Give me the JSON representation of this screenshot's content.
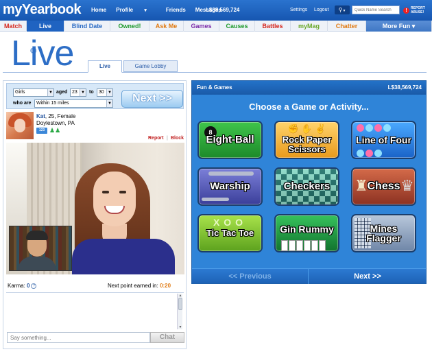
{
  "header": {
    "logo": "myYearbook",
    "nav": [
      "Home",
      "Profile",
      "Friends",
      "Messages"
    ],
    "profile_caret": "▾",
    "credits": "L$38,569,724",
    "settings": "Settings",
    "logout": "Logout",
    "search_placeholder": "Quick Name Search",
    "report_abuse": "REPORT ABUSE!"
  },
  "subnav": [
    {
      "label": "Match",
      "color": "#d6281e"
    },
    {
      "label": "Live",
      "color": "#ffffff",
      "active": true
    },
    {
      "label": "Blind Date",
      "color": "#2a6bc4"
    },
    {
      "label": "Owned!",
      "color": "#1f9a2e"
    },
    {
      "label": "Ask Me",
      "color": "#e07a12"
    },
    {
      "label": "Games",
      "color": "#7a2aa8"
    },
    {
      "label": "Causes",
      "color": "#1f9a2e"
    },
    {
      "label": "Battles",
      "color": "#d6281e"
    },
    {
      "label": "myMag",
      "color": "#6aa82a"
    },
    {
      "label": "Chatter",
      "color": "#e07a12"
    },
    {
      "label": "More Fun ▾",
      "color": "#ffffff",
      "more": true
    }
  ],
  "live": {
    "logo_text": "Live",
    "tabs": [
      "Live",
      "Game Lobby"
    ]
  },
  "filters": {
    "gender": "Girls",
    "aged_label": "aged",
    "age_min": "23",
    "to_label": "to",
    "age_max": "30",
    "who_are_label": "who are",
    "distance": "Within 15 miles",
    "next_button": "Next >>"
  },
  "profile": {
    "name": "Kat",
    "details": ", 25, Female",
    "location": "Doylestown, PA",
    "report": "Report",
    "separator": "|",
    "block": "Block",
    "badge": "123"
  },
  "stats": {
    "karma_label": "Karma:",
    "karma_value": "0",
    "help": "?",
    "next_point_label": "Next point earned in:",
    "next_point_value": "0:20"
  },
  "chat": {
    "placeholder": "Say something...",
    "button": "Chat"
  },
  "games_panel": {
    "title": "Fun & Games",
    "credits": "L$38,569,724",
    "heading": "Choose a Game or Activity...",
    "games": [
      {
        "label": "Eight-Ball",
        "icon": "8"
      },
      {
        "label": "Rock Paper Scissors",
        "icon": "✊ ✋ ✌"
      },
      {
        "label": "Line of Four",
        "icon": "circles"
      },
      {
        "label": "Warship",
        "icon": "ship"
      },
      {
        "label": "Checkers",
        "icon": "board"
      },
      {
        "label": "Chess",
        "icon": "♜ ♛"
      },
      {
        "label": "Tic Tac Toe",
        "icon": "X O"
      },
      {
        "label": "Gin Rummy",
        "icon": "cards"
      },
      {
        "label": "Mines Flagger",
        "icon": "grid"
      }
    ],
    "prev": "<< Previous",
    "next": "Next >>"
  }
}
